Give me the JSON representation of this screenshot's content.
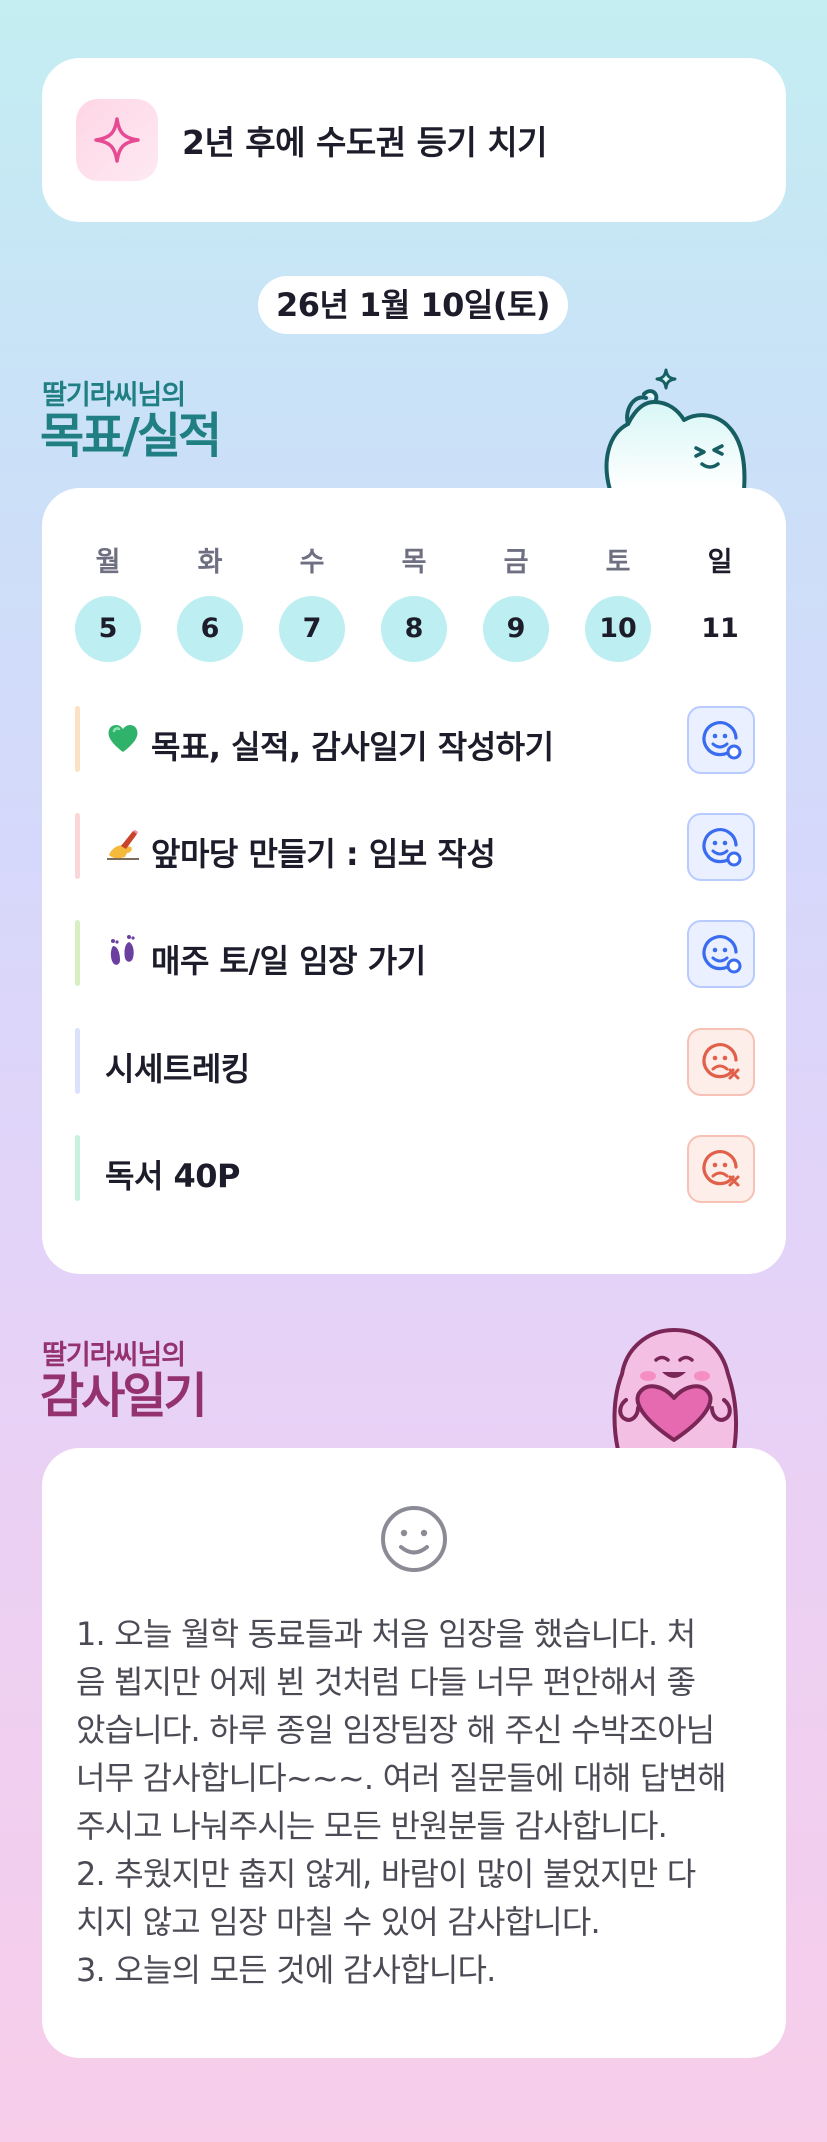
{
  "goal": {
    "title": "2년 후에 수도권 등기 치기",
    "icon": "sparkle-icon"
  },
  "date": "26년 1월 10일(토)",
  "goals_section": {
    "owner": "딸기라씨님의",
    "title": "목표/실적",
    "mascot": "thinking-mascot"
  },
  "week": {
    "days": [
      {
        "name": "월",
        "num": "5",
        "done": true
      },
      {
        "name": "화",
        "num": "6",
        "done": true
      },
      {
        "name": "수",
        "num": "7",
        "done": true
      },
      {
        "name": "목",
        "num": "8",
        "done": true
      },
      {
        "name": "금",
        "num": "9",
        "done": true
      },
      {
        "name": "토",
        "num": "10",
        "done": true
      },
      {
        "name": "일",
        "num": "11",
        "done": false
      }
    ]
  },
  "tasks": [
    {
      "label": "목표, 실적, 감사일기 작성하기",
      "emoji": "green-heart-icon",
      "bar_color": "#fbe2c4",
      "status": "achieved"
    },
    {
      "label": "앞마당 만들기 : 임보 작성",
      "emoji": "writing-hand-icon",
      "bar_color": "#fbd6d9",
      "status": "achieved"
    },
    {
      "label": "매주 토/일 임장 가기",
      "emoji": "footprints-icon",
      "bar_color": "#d7f0c2",
      "status": "achieved"
    },
    {
      "label": "시세트레킹",
      "emoji": "",
      "bar_color": "#dbe2fb",
      "status": "missed"
    },
    {
      "label": "독서 40P",
      "emoji": "",
      "bar_color": "#c7f2e0",
      "status": "missed"
    }
  ],
  "diary_section": {
    "owner": "딸기라씨님의",
    "title": "감사일기",
    "mascot": "heart-mascot"
  },
  "diary": {
    "mood_icon": "smile-icon",
    "text": "1. 오늘 월학 동료들과 처음 임장을 했습니다. 처\n음 뵙지만 어제 뵌 것처럼 다들 너무 편안해서 좋\n았습니다. 하루 종일 임장팀장 해 주신 수박조아님\n너무 감사합니다~~~. 여러 질문들에 대해 답변해\n주시고 나눠주시는 모든 반원분들 감사합니다.\n2. 추웠지만 춥지 않게, 바람이 많이 불었지만 다\n치지 않고 임장 마칠 수 있어 감사합니다.\n3. 오늘의 모든 것에 감사합니다."
  },
  "colors": {
    "teal": "#1f7f82",
    "purple": "#94316f",
    "achieved": "#3a6cf0",
    "missed": "#e0604a"
  }
}
